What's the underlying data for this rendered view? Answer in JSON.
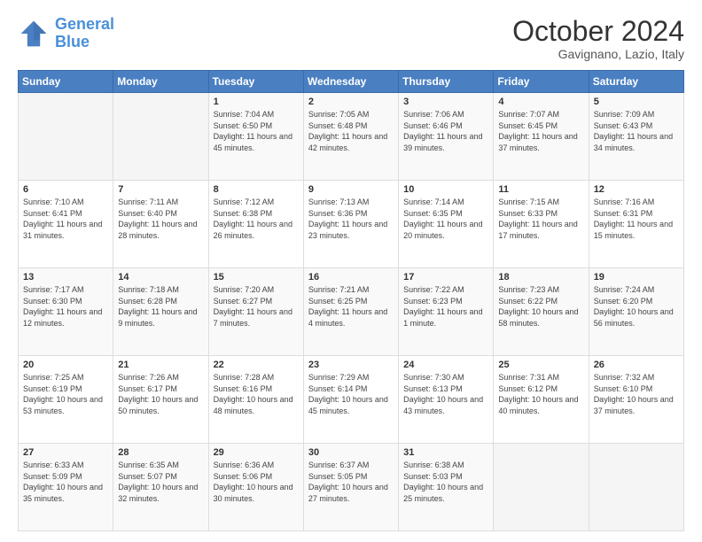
{
  "header": {
    "logo_general": "General",
    "logo_blue": "Blue",
    "month_title": "October 2024",
    "location": "Gavignano, Lazio, Italy"
  },
  "days_of_week": [
    "Sunday",
    "Monday",
    "Tuesday",
    "Wednesday",
    "Thursday",
    "Friday",
    "Saturday"
  ],
  "weeks": [
    [
      {
        "day": "",
        "sunrise": "",
        "sunset": "",
        "daylight": ""
      },
      {
        "day": "",
        "sunrise": "",
        "sunset": "",
        "daylight": ""
      },
      {
        "day": "1",
        "sunrise": "Sunrise: 7:04 AM",
        "sunset": "Sunset: 6:50 PM",
        "daylight": "Daylight: 11 hours and 45 minutes."
      },
      {
        "day": "2",
        "sunrise": "Sunrise: 7:05 AM",
        "sunset": "Sunset: 6:48 PM",
        "daylight": "Daylight: 11 hours and 42 minutes."
      },
      {
        "day": "3",
        "sunrise": "Sunrise: 7:06 AM",
        "sunset": "Sunset: 6:46 PM",
        "daylight": "Daylight: 11 hours and 39 minutes."
      },
      {
        "day": "4",
        "sunrise": "Sunrise: 7:07 AM",
        "sunset": "Sunset: 6:45 PM",
        "daylight": "Daylight: 11 hours and 37 minutes."
      },
      {
        "day": "5",
        "sunrise": "Sunrise: 7:09 AM",
        "sunset": "Sunset: 6:43 PM",
        "daylight": "Daylight: 11 hours and 34 minutes."
      }
    ],
    [
      {
        "day": "6",
        "sunrise": "Sunrise: 7:10 AM",
        "sunset": "Sunset: 6:41 PM",
        "daylight": "Daylight: 11 hours and 31 minutes."
      },
      {
        "day": "7",
        "sunrise": "Sunrise: 7:11 AM",
        "sunset": "Sunset: 6:40 PM",
        "daylight": "Daylight: 11 hours and 28 minutes."
      },
      {
        "day": "8",
        "sunrise": "Sunrise: 7:12 AM",
        "sunset": "Sunset: 6:38 PM",
        "daylight": "Daylight: 11 hours and 26 minutes."
      },
      {
        "day": "9",
        "sunrise": "Sunrise: 7:13 AM",
        "sunset": "Sunset: 6:36 PM",
        "daylight": "Daylight: 11 hours and 23 minutes."
      },
      {
        "day": "10",
        "sunrise": "Sunrise: 7:14 AM",
        "sunset": "Sunset: 6:35 PM",
        "daylight": "Daylight: 11 hours and 20 minutes."
      },
      {
        "day": "11",
        "sunrise": "Sunrise: 7:15 AM",
        "sunset": "Sunset: 6:33 PM",
        "daylight": "Daylight: 11 hours and 17 minutes."
      },
      {
        "day": "12",
        "sunrise": "Sunrise: 7:16 AM",
        "sunset": "Sunset: 6:31 PM",
        "daylight": "Daylight: 11 hours and 15 minutes."
      }
    ],
    [
      {
        "day": "13",
        "sunrise": "Sunrise: 7:17 AM",
        "sunset": "Sunset: 6:30 PM",
        "daylight": "Daylight: 11 hours and 12 minutes."
      },
      {
        "day": "14",
        "sunrise": "Sunrise: 7:18 AM",
        "sunset": "Sunset: 6:28 PM",
        "daylight": "Daylight: 11 hours and 9 minutes."
      },
      {
        "day": "15",
        "sunrise": "Sunrise: 7:20 AM",
        "sunset": "Sunset: 6:27 PM",
        "daylight": "Daylight: 11 hours and 7 minutes."
      },
      {
        "day": "16",
        "sunrise": "Sunrise: 7:21 AM",
        "sunset": "Sunset: 6:25 PM",
        "daylight": "Daylight: 11 hours and 4 minutes."
      },
      {
        "day": "17",
        "sunrise": "Sunrise: 7:22 AM",
        "sunset": "Sunset: 6:23 PM",
        "daylight": "Daylight: 11 hours and 1 minute."
      },
      {
        "day": "18",
        "sunrise": "Sunrise: 7:23 AM",
        "sunset": "Sunset: 6:22 PM",
        "daylight": "Daylight: 10 hours and 58 minutes."
      },
      {
        "day": "19",
        "sunrise": "Sunrise: 7:24 AM",
        "sunset": "Sunset: 6:20 PM",
        "daylight": "Daylight: 10 hours and 56 minutes."
      }
    ],
    [
      {
        "day": "20",
        "sunrise": "Sunrise: 7:25 AM",
        "sunset": "Sunset: 6:19 PM",
        "daylight": "Daylight: 10 hours and 53 minutes."
      },
      {
        "day": "21",
        "sunrise": "Sunrise: 7:26 AM",
        "sunset": "Sunset: 6:17 PM",
        "daylight": "Daylight: 10 hours and 50 minutes."
      },
      {
        "day": "22",
        "sunrise": "Sunrise: 7:28 AM",
        "sunset": "Sunset: 6:16 PM",
        "daylight": "Daylight: 10 hours and 48 minutes."
      },
      {
        "day": "23",
        "sunrise": "Sunrise: 7:29 AM",
        "sunset": "Sunset: 6:14 PM",
        "daylight": "Daylight: 10 hours and 45 minutes."
      },
      {
        "day": "24",
        "sunrise": "Sunrise: 7:30 AM",
        "sunset": "Sunset: 6:13 PM",
        "daylight": "Daylight: 10 hours and 43 minutes."
      },
      {
        "day": "25",
        "sunrise": "Sunrise: 7:31 AM",
        "sunset": "Sunset: 6:12 PM",
        "daylight": "Daylight: 10 hours and 40 minutes."
      },
      {
        "day": "26",
        "sunrise": "Sunrise: 7:32 AM",
        "sunset": "Sunset: 6:10 PM",
        "daylight": "Daylight: 10 hours and 37 minutes."
      }
    ],
    [
      {
        "day": "27",
        "sunrise": "Sunrise: 6:33 AM",
        "sunset": "Sunset: 5:09 PM",
        "daylight": "Daylight: 10 hours and 35 minutes."
      },
      {
        "day": "28",
        "sunrise": "Sunrise: 6:35 AM",
        "sunset": "Sunset: 5:07 PM",
        "daylight": "Daylight: 10 hours and 32 minutes."
      },
      {
        "day": "29",
        "sunrise": "Sunrise: 6:36 AM",
        "sunset": "Sunset: 5:06 PM",
        "daylight": "Daylight: 10 hours and 30 minutes."
      },
      {
        "day": "30",
        "sunrise": "Sunrise: 6:37 AM",
        "sunset": "Sunset: 5:05 PM",
        "daylight": "Daylight: 10 hours and 27 minutes."
      },
      {
        "day": "31",
        "sunrise": "Sunrise: 6:38 AM",
        "sunset": "Sunset: 5:03 PM",
        "daylight": "Daylight: 10 hours and 25 minutes."
      },
      {
        "day": "",
        "sunrise": "",
        "sunset": "",
        "daylight": ""
      },
      {
        "day": "",
        "sunrise": "",
        "sunset": "",
        "daylight": ""
      }
    ]
  ]
}
